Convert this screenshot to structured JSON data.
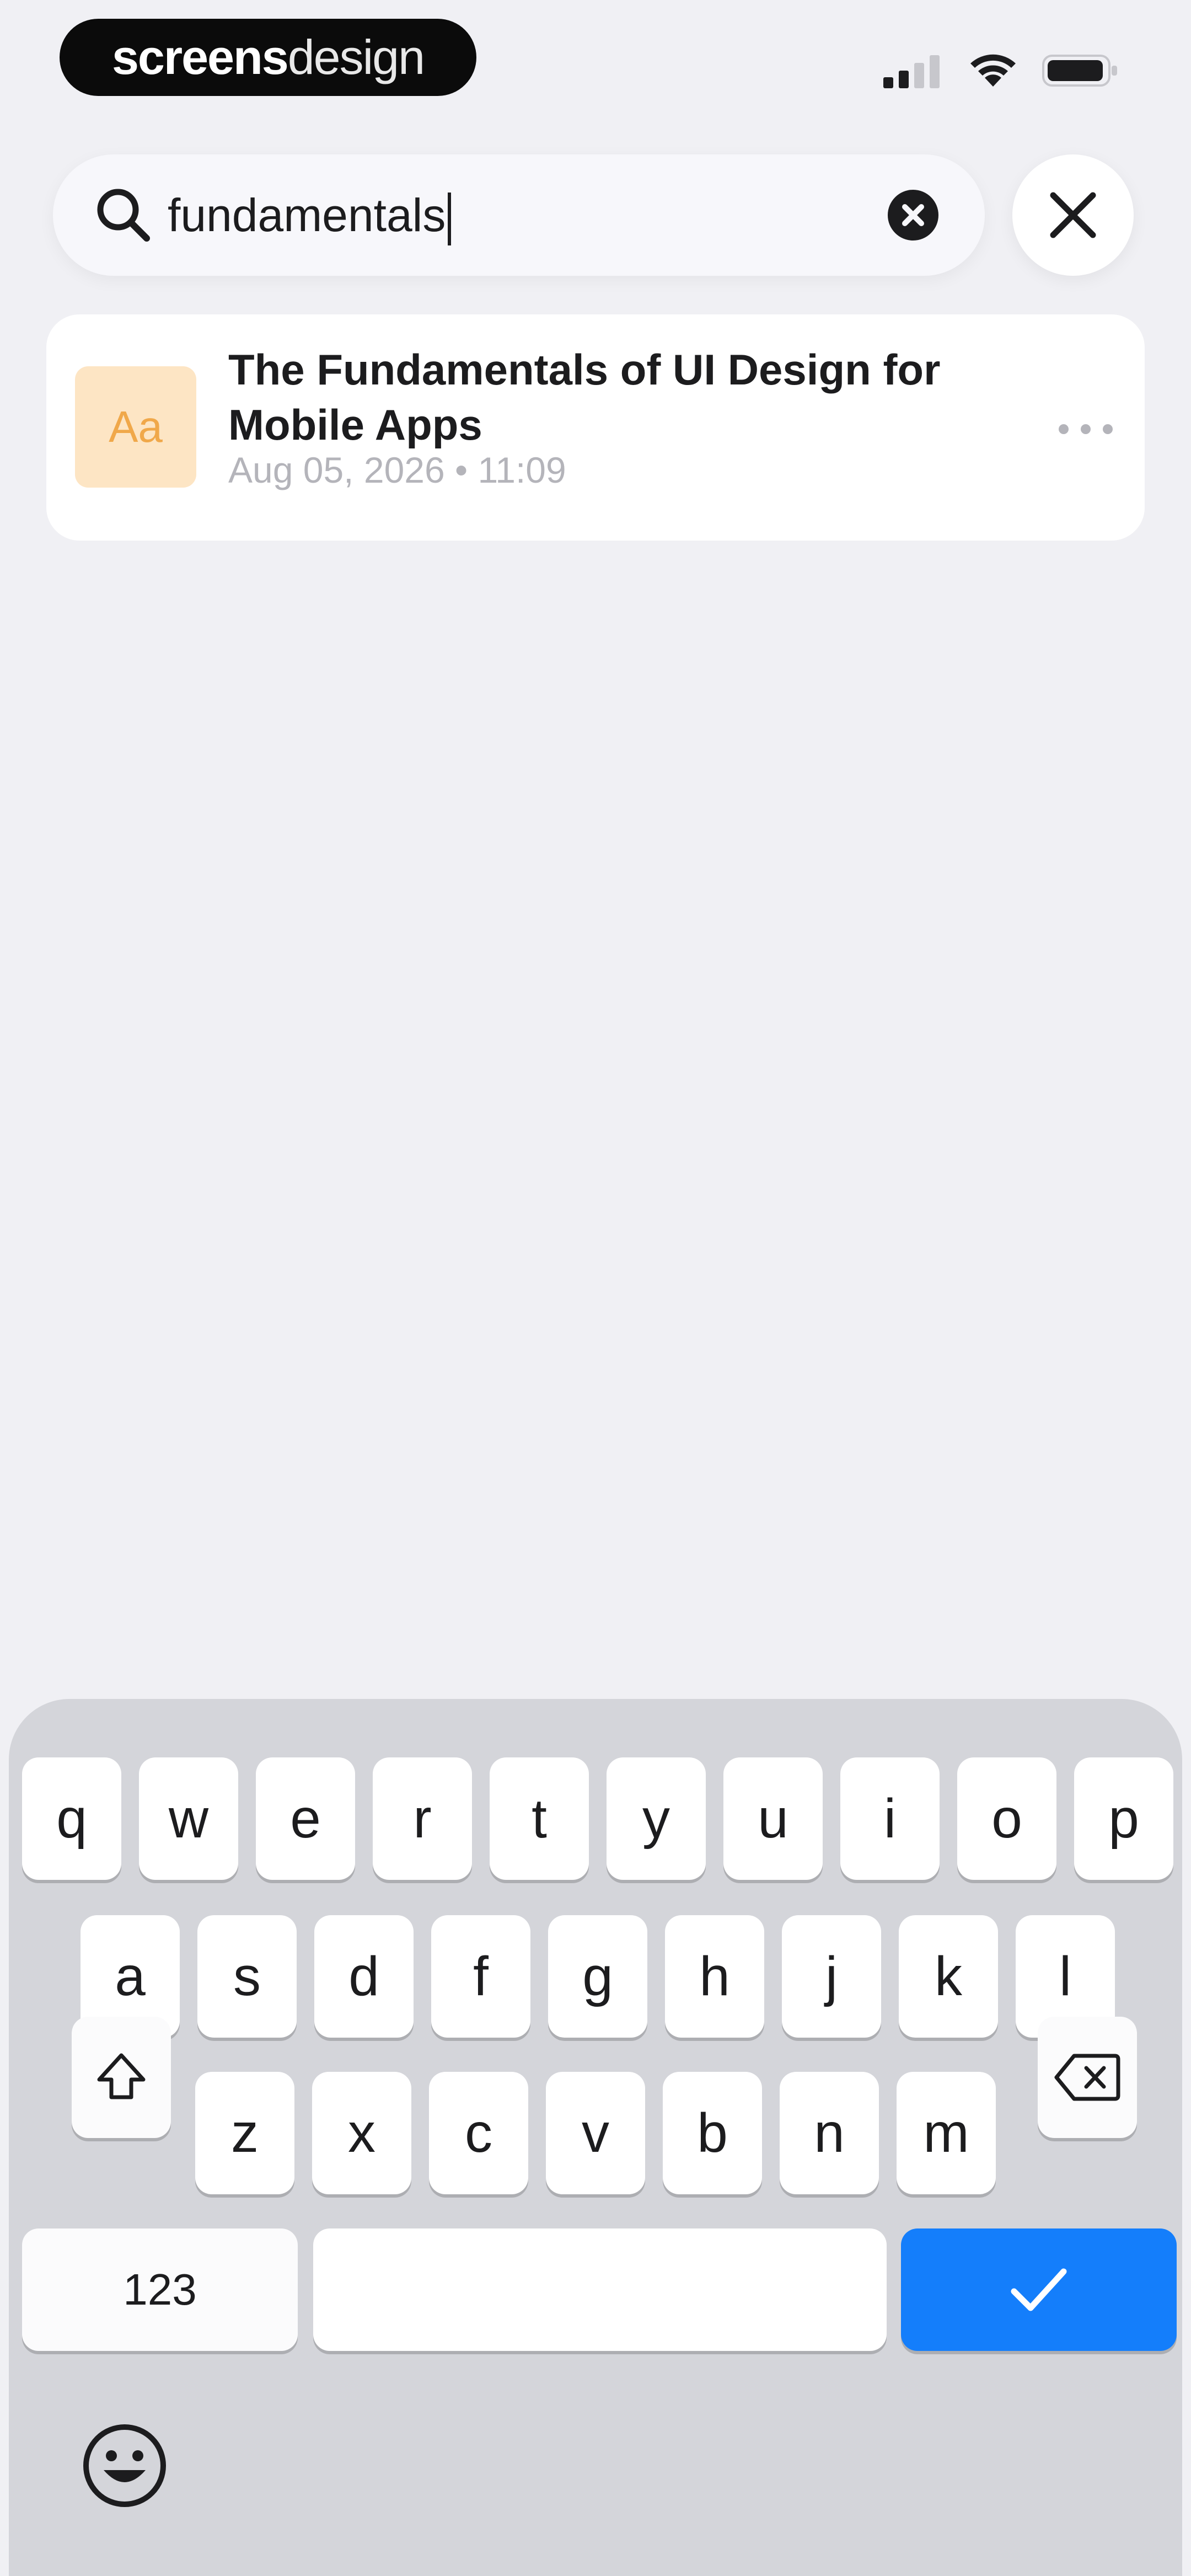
{
  "status_bar": {
    "brand_bold": "screens",
    "brand_thin": "design"
  },
  "search": {
    "query": "fundamentals",
    "clear_icon": "clear-circle-icon",
    "search_icon": "magnifier-icon",
    "close_icon": "close-x-icon"
  },
  "results": [
    {
      "thumb_label": "Aa",
      "title": "The Fundamentals of UI Design for Mobile Apps",
      "meta": "Aug 05, 2026 • 11:09",
      "more_icon": "ellipsis-icon"
    }
  ],
  "keyboard": {
    "row1": [
      "q",
      "w",
      "e",
      "r",
      "t",
      "y",
      "u",
      "i",
      "o",
      "p"
    ],
    "row2": [
      "a",
      "s",
      "d",
      "f",
      "g",
      "h",
      "j",
      "k",
      "l"
    ],
    "row3": [
      "z",
      "x",
      "c",
      "v",
      "b",
      "n",
      "m"
    ],
    "numbers_label": "123",
    "shift_icon": "shift-icon",
    "delete_icon": "backspace-icon",
    "return_icon": "checkmark-icon",
    "emoji_icon": "emoji-icon",
    "accent_color": "#147efb"
  },
  "colors": {
    "background": "#f0f0f4",
    "thumb_bg": "#fde5c4",
    "thumb_text": "#f0a84a"
  }
}
